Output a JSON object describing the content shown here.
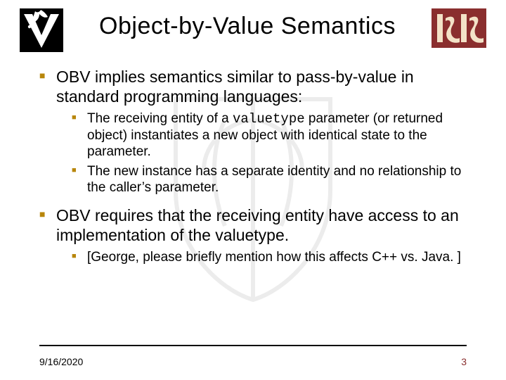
{
  "title": "Object-by-Value Semantics",
  "bullets": {
    "b1": "OBV implies semantics similar to pass-by-value in standard programming languages:",
    "b1_1a": "The receiving entity of a ",
    "b1_1_code": "valuetype",
    "b1_1b": " parameter (or returned object) instantiates a new object with identical state to the parameter.",
    "b1_2": "The new instance has a separate identity and no relationship to the caller’s parameter.",
    "b2": "OBV requires that the receiving entity have access to an implementation of the valuetype.",
    "b2_1": "[George, please briefly mention how this affects C++ vs. Java. ]"
  },
  "footer": {
    "date": "9/16/2020",
    "page": "3"
  }
}
